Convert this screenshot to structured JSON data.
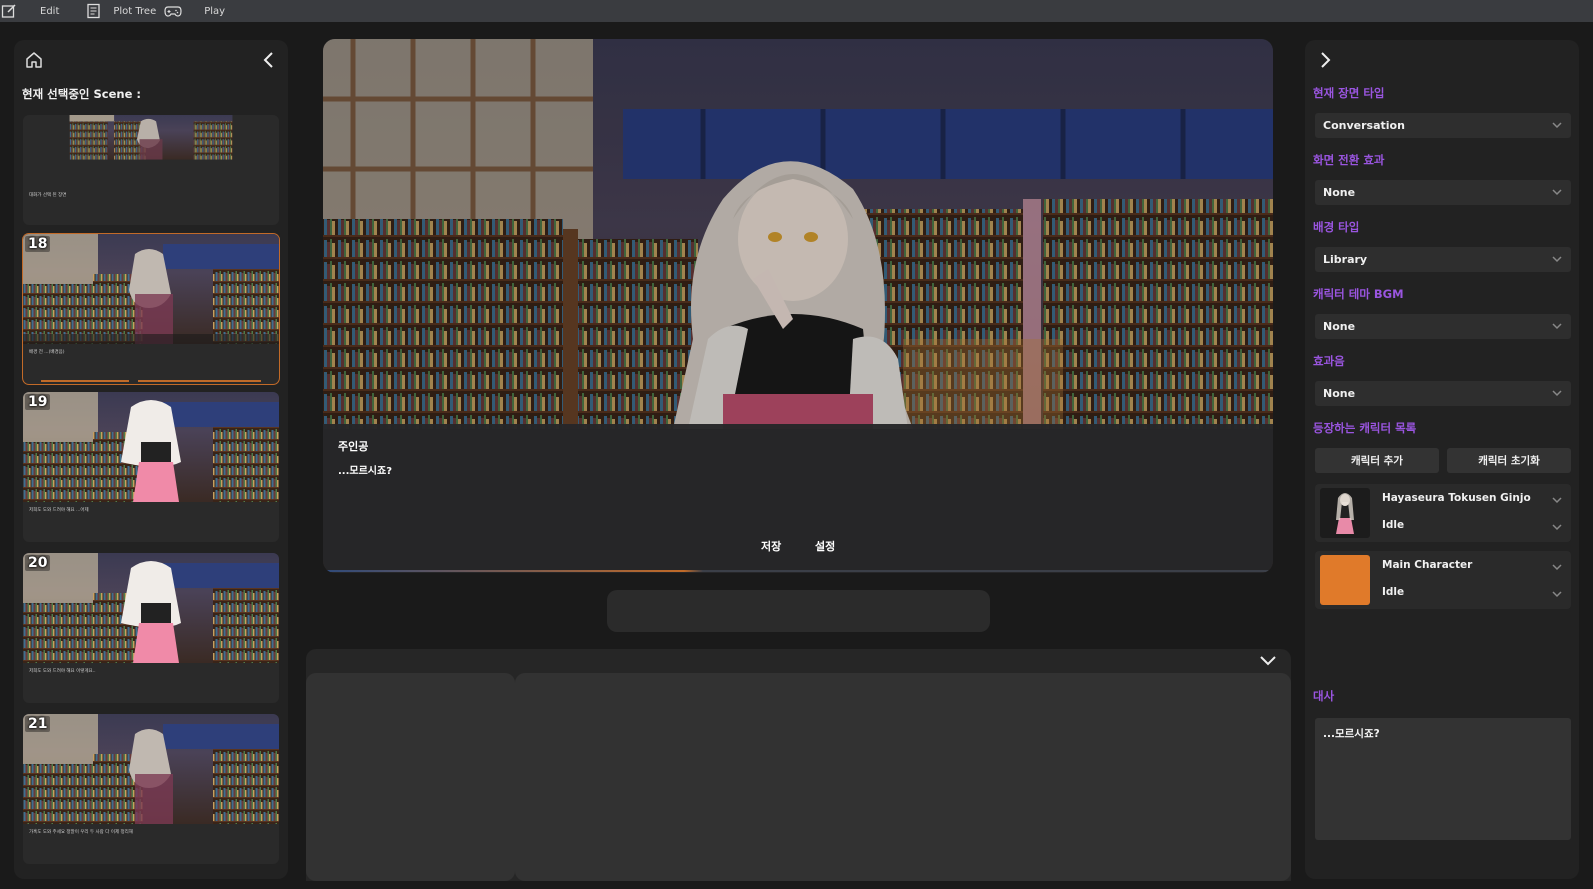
{
  "topbar": {
    "items": [
      {
        "label": "Edit"
      },
      {
        "label": "Plot Tree"
      },
      {
        "label": "Play"
      }
    ]
  },
  "left_panel": {
    "title": "현재 선택중인 Scene :",
    "scenes": [
      {
        "number": "",
        "text": "대화가 선택 된 장면"
      },
      {
        "number": "18",
        "text": "배경 전 ...(배경음)"
      },
      {
        "number": "19",
        "text": "저희도 도와 드려야 해요 ...어제"
      },
      {
        "number": "20",
        "text": "저희도 도와 드려야 해요 이렇게요.."
      },
      {
        "number": "21",
        "text": "가혹도 도와 주세요 정말이 우리 두 사람 다 이제 정리해"
      }
    ]
  },
  "viewer": {
    "speaker": "주인공",
    "line": "...모르시죠?",
    "save_label": "저장",
    "settings_label": "설정"
  },
  "right_panel": {
    "scene_type_label": "현재 장면 타입",
    "scene_type_value": "Conversation",
    "transition_label": "화면 전환 효과",
    "transition_value": "None",
    "background_label": "배경 타입",
    "background_value": "Library",
    "bgm_label": "캐릭터 테마 BGM",
    "bgm_value": "None",
    "sfx_label": "효과음",
    "sfx_value": "None",
    "characters_label": "등장하는 캐릭터 목록",
    "add_character_label": "캐릭터 추가",
    "reset_character_label": "캐릭터 초기화",
    "characters": [
      {
        "name": "Hayaseura Tokusen Ginjo",
        "state": "Idle"
      },
      {
        "name": "Main Character",
        "state": "Idle"
      }
    ],
    "dialogue_label": "대사",
    "dialogue_value": "...모르시죠?"
  },
  "colors": {
    "accent_purple": "#9a55e0",
    "accent_orange": "#e07a2a",
    "panel_bg": "#222222",
    "topbar_bg": "#3a3c40"
  }
}
